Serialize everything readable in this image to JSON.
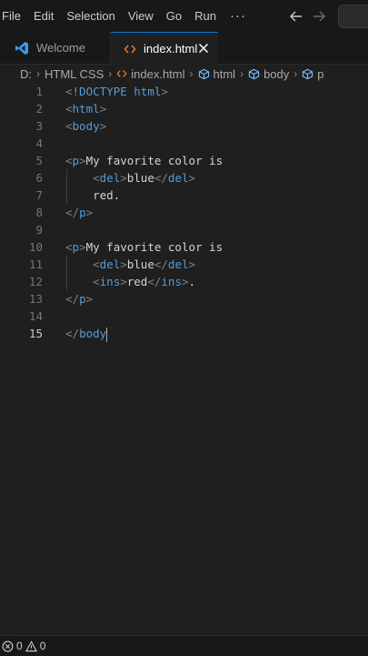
{
  "menu": {
    "items": [
      "File",
      "Edit",
      "Selection",
      "View",
      "Go",
      "Run"
    ],
    "more": "···"
  },
  "tabs": [
    {
      "label": "Welcome",
      "active": false
    },
    {
      "label": "index.html",
      "active": true
    }
  ],
  "breadcrumb": {
    "items": [
      "D:",
      "HTML CSS",
      "index.html",
      "html",
      "body",
      "p"
    ]
  },
  "editor": {
    "active_line": 15,
    "lines": [
      {
        "n": "1",
        "text": "<!DOCTYPE html>"
      },
      {
        "n": "2",
        "text": "<html>"
      },
      {
        "n": "3",
        "text": "<body>"
      },
      {
        "n": "4",
        "text": ""
      },
      {
        "n": "5",
        "text": "<p>My favorite color is"
      },
      {
        "n": "6",
        "text": "    <del>blue</del>"
      },
      {
        "n": "7",
        "text": "    red."
      },
      {
        "n": "8",
        "text": "</p>"
      },
      {
        "n": "9",
        "text": ""
      },
      {
        "n": "10",
        "text": "<p>My favorite color is"
      },
      {
        "n": "11",
        "text": "    <del>blue</del>"
      },
      {
        "n": "12",
        "text": "    <ins>red</ins>."
      },
      {
        "n": "13",
        "text": "</p>"
      },
      {
        "n": "14",
        "text": ""
      },
      {
        "n": "15",
        "text": "</body"
      }
    ]
  },
  "status": {
    "errors": "0",
    "warnings": "0"
  },
  "colors": {
    "accent": "#0078d4",
    "tag": "#569cd6",
    "bracket": "#808080",
    "html_icon": "#e37933",
    "vscode_blue": "#3b9bf4"
  }
}
